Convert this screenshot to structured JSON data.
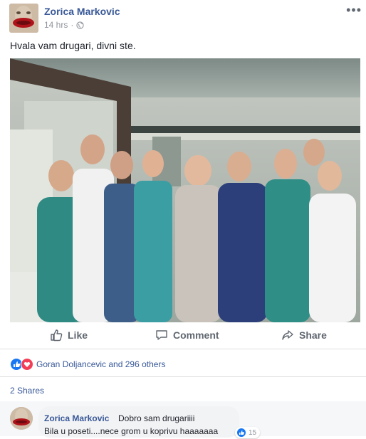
{
  "post": {
    "author": "Zorica Markovic",
    "time": "14 hrs",
    "separator": "·",
    "more_label": "•••",
    "text": "Hvala vam drugari, divni ste."
  },
  "actions": {
    "like": "Like",
    "comment": "Comment",
    "share": "Share"
  },
  "reactions": {
    "summary": "Goran Doljancevic and 296 others"
  },
  "shares": {
    "label": "2 Shares"
  },
  "comment": {
    "author": "Zorica Markovic",
    "line1": "Dobro sam drugariiii",
    "line2": "Bila u poseti....nece grom u koprivu haaaaaaa",
    "likes": "15"
  },
  "colors": {
    "link": "#385898",
    "like_blue": "#1877f2",
    "love_red": "#f33e58"
  }
}
